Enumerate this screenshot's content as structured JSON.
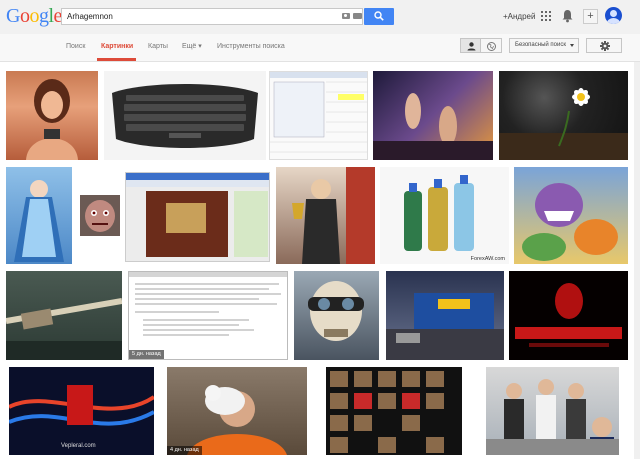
{
  "header": {
    "logo_letters": [
      {
        "ch": "G",
        "color": "#4285f4"
      },
      {
        "ch": "o",
        "color": "#ea4335"
      },
      {
        "ch": "o",
        "color": "#fbbc05"
      },
      {
        "ch": "g",
        "color": "#4285f4"
      },
      {
        "ch": "l",
        "color": "#34a853"
      },
      {
        "ch": "e",
        "color": "#ea4335"
      }
    ],
    "search_query": "Arhagemnon",
    "user_name": "+Андрей"
  },
  "nav": {
    "search": "Поиск",
    "images": "Картинки",
    "maps": "Карты",
    "more": "Ещё ▾",
    "tools": "Инструменты поиска",
    "safe_search": "Безопасный поиск"
  },
  "images": {
    "captions": {
      "r2c4_source": "ForexAW.com",
      "r3c2_age": "5 дн. назад",
      "r4c1_source": "Vepleral.com",
      "r4c2_age": "4 дн. назад"
    }
  },
  "colors": {
    "accent_red": "#dd4b39",
    "search_blue": "#4285f4"
  }
}
